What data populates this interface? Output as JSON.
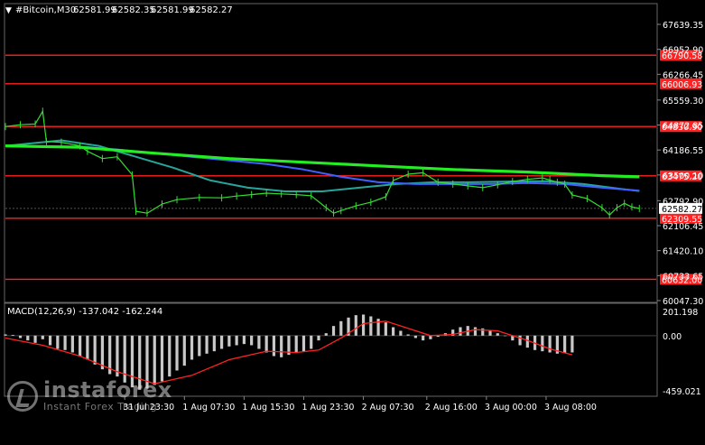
{
  "chart_data": {
    "type": "line",
    "title": "#Bitcoin,M30",
    "ohlc": [
      "62581.99",
      "62582.35",
      "62581.99",
      "62582.27"
    ],
    "price_axis_ticks": [
      "67639.35",
      "66952.90",
      "66266.45",
      "65559.30",
      "64872.85",
      "64186.55",
      "63500.10",
      "62792.90",
      "62106.45",
      "61420.10",
      "60733.65",
      "60047.30"
    ],
    "price_range": [
      60047.3,
      67639.35
    ],
    "current_price": "62582.27",
    "levels": [
      {
        "label": "66790.58",
        "value": 66790.58
      },
      {
        "label": "66006.93",
        "value": 66006.93
      },
      {
        "label": "64830.90",
        "value": 64830.9
      },
      {
        "label": "63475.20",
        "value": 63475.2
      },
      {
        "label": "62309.55",
        "value": 62309.55
      },
      {
        "label": "60632.00",
        "value": 60632.0
      }
    ],
    "time_labels": [
      "31 Jul 23:30",
      "1 Aug 07:30",
      "1 Aug 15:30",
      "1 Aug 23:30",
      "2 Aug 07:30",
      "2 Aug 16:00",
      "3 Aug 00:00",
      "3 Aug 08:00"
    ],
    "time_label_index": [
      32,
      48,
      64,
      80,
      96,
      113,
      129,
      145
    ],
    "bar_count": 170,
    "price_series": [
      {
        "name": "price",
        "color": "#33dd33",
        "points": [
          [
            0,
            64830
          ],
          [
            4,
            64880
          ],
          [
            8,
            64900
          ],
          [
            10,
            65250
          ],
          [
            11,
            64420
          ],
          [
            15,
            64400
          ],
          [
            20,
            64300
          ],
          [
            22,
            64150
          ],
          [
            26,
            63950
          ],
          [
            30,
            64000
          ],
          [
            34,
            63500
          ],
          [
            35,
            62500
          ],
          [
            38,
            62450
          ],
          [
            42,
            62700
          ],
          [
            46,
            62820
          ],
          [
            52,
            62880
          ],
          [
            58,
            62870
          ],
          [
            62,
            62920
          ],
          [
            66,
            62960
          ],
          [
            70,
            63000
          ],
          [
            74,
            62980
          ],
          [
            78,
            62960
          ],
          [
            82,
            62930
          ],
          [
            86,
            62600
          ],
          [
            88,
            62450
          ],
          [
            90,
            62520
          ],
          [
            94,
            62650
          ],
          [
            98,
            62750
          ],
          [
            102,
            62900
          ],
          [
            104,
            63350
          ],
          [
            108,
            63520
          ],
          [
            112,
            63560
          ],
          [
            116,
            63300
          ],
          [
            120,
            63250
          ],
          [
            124,
            63200
          ],
          [
            128,
            63150
          ],
          [
            132,
            63230
          ],
          [
            136,
            63320
          ],
          [
            140,
            63380
          ],
          [
            144,
            63420
          ],
          [
            146,
            63360
          ],
          [
            148,
            63300
          ],
          [
            150,
            63250
          ],
          [
            152,
            62950
          ],
          [
            156,
            62850
          ],
          [
            160,
            62600
          ],
          [
            162,
            62400
          ],
          [
            164,
            62600
          ],
          [
            166,
            62720
          ],
          [
            168,
            62620
          ],
          [
            170,
            62580
          ]
        ]
      }
    ],
    "ma_series": [
      {
        "name": "ma-fast",
        "color": "#26a69a",
        "points": [
          [
            0,
            64300
          ],
          [
            15,
            64450
          ],
          [
            25,
            64300
          ],
          [
            35,
            64000
          ],
          [
            45,
            63700
          ],
          [
            55,
            63350
          ],
          [
            65,
            63150
          ],
          [
            75,
            63050
          ],
          [
            85,
            63050
          ],
          [
            95,
            63150
          ],
          [
            105,
            63250
          ],
          [
            115,
            63300
          ],
          [
            125,
            63300
          ],
          [
            135,
            63320
          ],
          [
            145,
            63330
          ],
          [
            155,
            63250
          ],
          [
            165,
            63120
          ],
          [
            170,
            63060
          ]
        ]
      },
      {
        "name": "ma-mid",
        "color": "#4060ff",
        "points": [
          [
            0,
            64300
          ],
          [
            20,
            64280
          ],
          [
            30,
            64200
          ],
          [
            40,
            64100
          ],
          [
            50,
            64000
          ],
          [
            60,
            63900
          ],
          [
            70,
            63800
          ],
          [
            80,
            63650
          ],
          [
            90,
            63450
          ],
          [
            100,
            63300
          ],
          [
            110,
            63250
          ],
          [
            120,
            63250
          ],
          [
            130,
            63250
          ],
          [
            140,
            63280
          ],
          [
            150,
            63250
          ],
          [
            160,
            63150
          ],
          [
            170,
            63070
          ]
        ]
      },
      {
        "name": "ma-slow",
        "color": "#22ee22",
        "points": [
          [
            0,
            64300
          ],
          [
            20,
            64260
          ],
          [
            40,
            64100
          ],
          [
            60,
            63950
          ],
          [
            80,
            63850
          ],
          [
            100,
            63750
          ],
          [
            120,
            63650
          ],
          [
            140,
            63580
          ],
          [
            160,
            63480
          ],
          [
            170,
            63450
          ]
        ]
      }
    ],
    "macd": {
      "label": "MACD(12,26,9) -137.042 -162.244",
      "ticks": [
        "201.198",
        "0.00",
        "-459.021"
      ],
      "range": [
        -459.021,
        201.198
      ],
      "histogram": [
        [
          0,
          10
        ],
        [
          2,
          6
        ],
        [
          4,
          -20
        ],
        [
          6,
          -40
        ],
        [
          8,
          -60
        ],
        [
          10,
          -30
        ],
        [
          12,
          -80
        ],
        [
          14,
          -110
        ],
        [
          16,
          -120
        ],
        [
          18,
          -140
        ],
        [
          20,
          -170
        ],
        [
          22,
          -200
        ],
        [
          24,
          -240
        ],
        [
          26,
          -280
        ],
        [
          28,
          -320
        ],
        [
          30,
          -340
        ],
        [
          32,
          -390
        ],
        [
          34,
          -430
        ],
        [
          36,
          -450
        ],
        [
          38,
          -440
        ],
        [
          40,
          -410
        ],
        [
          42,
          -380
        ],
        [
          44,
          -340
        ],
        [
          46,
          -290
        ],
        [
          48,
          -250
        ],
        [
          50,
          -200
        ],
        [
          52,
          -170
        ],
        [
          54,
          -150
        ],
        [
          56,
          -130
        ],
        [
          58,
          -110
        ],
        [
          60,
          -90
        ],
        [
          62,
          -80
        ],
        [
          64,
          -70
        ],
        [
          66,
          -80
        ],
        [
          68,
          -110
        ],
        [
          70,
          -140
        ],
        [
          72,
          -170
        ],
        [
          74,
          -180
        ],
        [
          76,
          -160
        ],
        [
          78,
          -140
        ],
        [
          80,
          -130
        ],
        [
          82,
          -110
        ],
        [
          84,
          -40
        ],
        [
          86,
          20
        ],
        [
          88,
          80
        ],
        [
          90,
          120
        ],
        [
          92,
          150
        ],
        [
          94,
          170
        ],
        [
          96,
          175
        ],
        [
          98,
          160
        ],
        [
          100,
          140
        ],
        [
          102,
          110
        ],
        [
          104,
          70
        ],
        [
          106,
          40
        ],
        [
          108,
          10
        ],
        [
          110,
          -20
        ],
        [
          112,
          -40
        ],
        [
          114,
          -30
        ],
        [
          116,
          -10
        ],
        [
          118,
          20
        ],
        [
          120,
          50
        ],
        [
          122,
          70
        ],
        [
          124,
          80
        ],
        [
          126,
          70
        ],
        [
          128,
          60
        ],
        [
          130,
          40
        ],
        [
          132,
          20
        ],
        [
          134,
          0
        ],
        [
          136,
          -40
        ],
        [
          138,
          -80
        ],
        [
          140,
          -100
        ],
        [
          142,
          -120
        ],
        [
          144,
          -130
        ],
        [
          146,
          -140
        ],
        [
          148,
          -150
        ],
        [
          150,
          -145
        ],
        [
          152,
          -140
        ]
      ],
      "signal": {
        "name": "signal",
        "color": "#ff2222",
        "points": [
          [
            0,
            -20
          ],
          [
            10,
            -80
          ],
          [
            20,
            -170
          ],
          [
            30,
            -300
          ],
          [
            40,
            -400
          ],
          [
            50,
            -330
          ],
          [
            60,
            -200
          ],
          [
            70,
            -130
          ],
          [
            78,
            -140
          ],
          [
            84,
            -120
          ],
          [
            90,
            -20
          ],
          [
            96,
            100
          ],
          [
            102,
            120
          ],
          [
            108,
            60
          ],
          [
            114,
            0
          ],
          [
            120,
            10
          ],
          [
            126,
            50
          ],
          [
            132,
            40
          ],
          [
            140,
            -40
          ],
          [
            146,
            -110
          ],
          [
            152,
            -160
          ]
        ]
      }
    },
    "grid": false
  },
  "watermark": {
    "brand": "instaforex",
    "tagline": "Instant Forex Trading"
  }
}
